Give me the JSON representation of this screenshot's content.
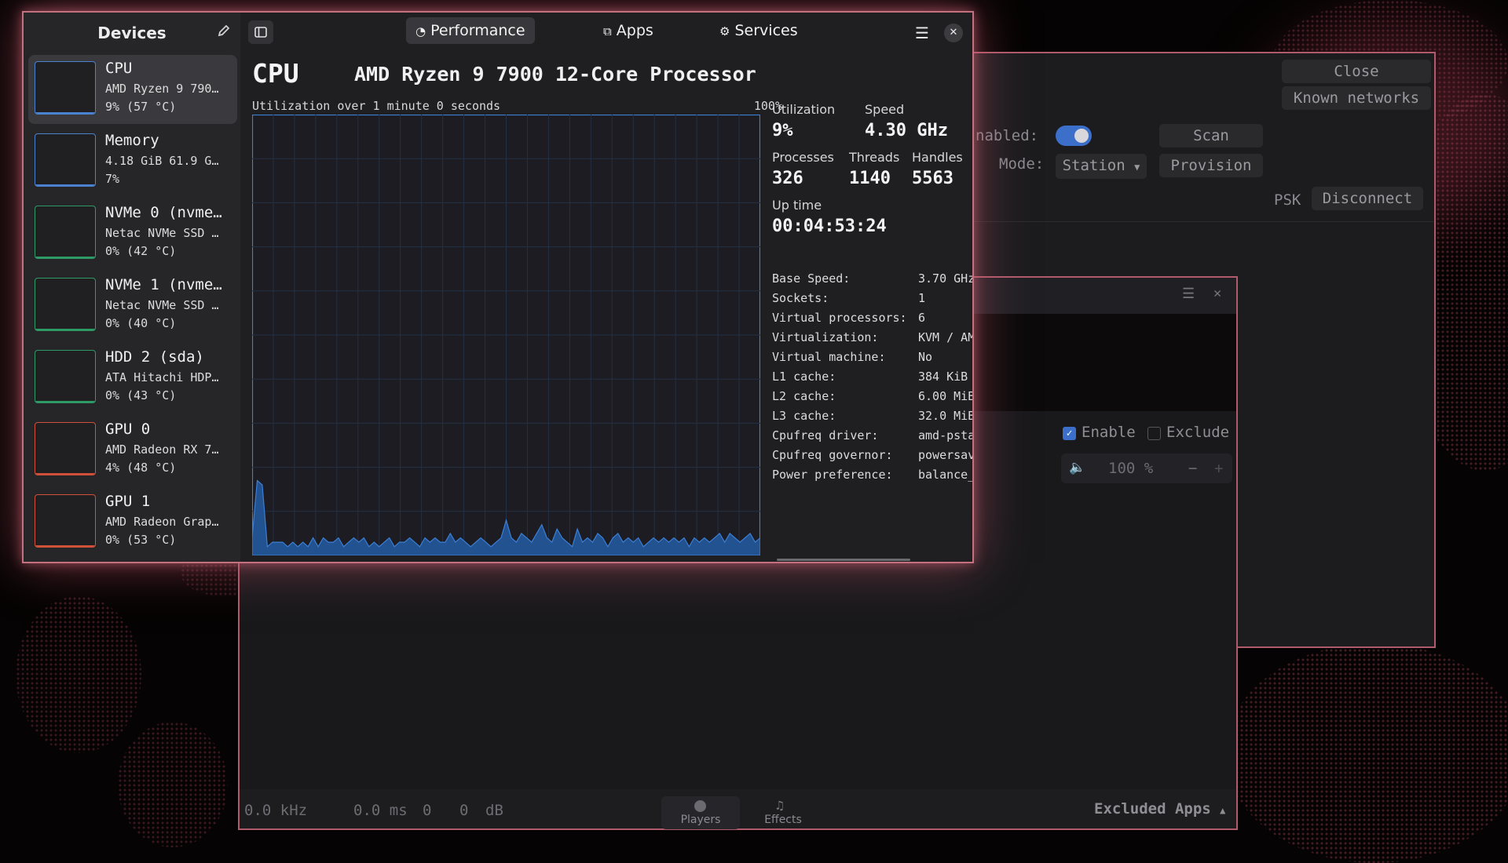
{
  "wifi_window": {
    "close_label": "Close",
    "known_networks_label": "Known networks",
    "enabled_label": "nabled:",
    "scan_label": "Scan",
    "mode_label": "Mode:",
    "mode_value": "Station",
    "provision_label": "Provision",
    "psk_label": "PSK",
    "disconnect_label": "Disconnect"
  },
  "effects_window": {
    "enable_label": "Enable",
    "exclude_label": "Exclude",
    "volume_value": "100 %",
    "minus_label": "−",
    "plus_label": "+",
    "footer_freq": "0.0 kHz",
    "footer_latency": "0.0 ms",
    "footer_val1": "0",
    "footer_val2": "0",
    "footer_db": "dB",
    "players_label": "Players",
    "effects_label": "Effects",
    "excluded_apps_label": "Excluded Apps"
  },
  "sidebar": {
    "title": "Devices",
    "devices": [
      {
        "name": "CPU",
        "sub": "AMD Ryzen 9 790…",
        "stat": "9% (57 °C)",
        "color": "#4a82d0"
      },
      {
        "name": "Memory",
        "sub": "4.18 GiB 61.9 G…",
        "stat": "7%",
        "color": "#4a82d0"
      },
      {
        "name": "NVMe 0 (nvme…",
        "sub": "Netac NVMe SSD …",
        "stat": "0% (42 °C)",
        "color": "#2e9a66"
      },
      {
        "name": "NVMe 1 (nvme…",
        "sub": "Netac NVMe SSD …",
        "stat": "0% (40 °C)",
        "color": "#2e9a66"
      },
      {
        "name": "HDD 2 (sda)",
        "sub": "ATA Hitachi HDP…",
        "stat": "0% (43 °C)",
        "color": "#2e9a66"
      },
      {
        "name": "GPU 0",
        "sub": "AMD Radeon RX 7…",
        "stat": "4% (48 °C)",
        "color": "#d0503a"
      },
      {
        "name": "GPU 1",
        "sub": "AMD Radeon Grap…",
        "stat": "0% (53 °C)",
        "color": "#d0503a"
      }
    ]
  },
  "tabs": {
    "performance": "Performance",
    "apps": "Apps",
    "services": "Services"
  },
  "cpu": {
    "title": "CPU",
    "model": "AMD Ryzen 9 7900 12-Core Processor",
    "graph_caption": "Utilization over 1 minute 0 seconds",
    "graph_max": "100%",
    "utilization_label": "Utilization",
    "utilization_value": "9%",
    "speed_label": "Speed",
    "speed_value": "4.30 GHz",
    "processes_label": "Processes",
    "processes_value": "326",
    "threads_label": "Threads",
    "threads_value": "1140",
    "handles_label": "Handles",
    "handles_value": "5563",
    "uptime_label": "Up time",
    "uptime_value": "00:04:53:24",
    "details": [
      {
        "k": "Base Speed:",
        "v": "3.70 GHz"
      },
      {
        "k": "Sockets:",
        "v": "1"
      },
      {
        "k": "Virtual processors:",
        "v": "6"
      },
      {
        "k": "Virtualization:",
        "v": "KVM / AM"
      },
      {
        "k": "Virtual machine:",
        "v": "No"
      },
      {
        "k": "L1 cache:",
        "v": "384 KiB"
      },
      {
        "k": "L2 cache:",
        "v": "6.00 MiB"
      },
      {
        "k": "L3 cache:",
        "v": "32.0 MiB"
      },
      {
        "k": "Cpufreq driver:",
        "v": "amd-psta"
      },
      {
        "k": "Cpufreq governor:",
        "v": "powersav"
      },
      {
        "k": "Power preference:",
        "v": "balance_"
      }
    ],
    "utilization_history": [
      4,
      17,
      16,
      2,
      3,
      3,
      3,
      2,
      3,
      2,
      3,
      2,
      4,
      2,
      4,
      3,
      3,
      4,
      2,
      3,
      4,
      3,
      4,
      2,
      3,
      2,
      3,
      4,
      2,
      3,
      3,
      4,
      3,
      2,
      4,
      3,
      4,
      3,
      3,
      5,
      3,
      4,
      3,
      2,
      3,
      4,
      3,
      2,
      3,
      4,
      8,
      4,
      3,
      5,
      4,
      3,
      5,
      7,
      4,
      3,
      6,
      4,
      3,
      2,
      6,
      3,
      4,
      3,
      5,
      4,
      2,
      4,
      5,
      3,
      4,
      3,
      4,
      2,
      3,
      4,
      3,
      4,
      3,
      4,
      3,
      4,
      2,
      4,
      3,
      4,
      3,
      4,
      5,
      3,
      5,
      4,
      3,
      4,
      5,
      3,
      4
    ]
  },
  "colors": {
    "accent": "#3b7fd6",
    "border": "#c4707f"
  }
}
